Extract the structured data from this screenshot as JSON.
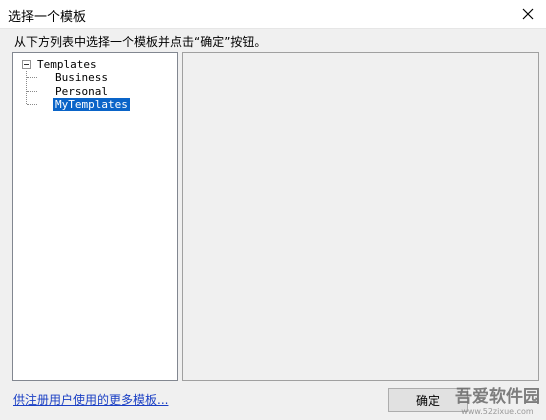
{
  "window": {
    "title": "选择一个模板"
  },
  "instruction": "从下方列表中选择一个模板并点击“确定”按钮。",
  "tree": {
    "root": "Templates",
    "children": [
      "Business",
      "Personal",
      "MyTemplates"
    ],
    "selected_index": 2
  },
  "footer": {
    "link": "供注册用户使用的更多模板...",
    "ok_label": "确定"
  },
  "watermark": {
    "text": "吾爱软件园",
    "url": "www.52zixue.com"
  },
  "colors": {
    "selection": "#0a64c8",
    "link": "#1a3fc4"
  }
}
